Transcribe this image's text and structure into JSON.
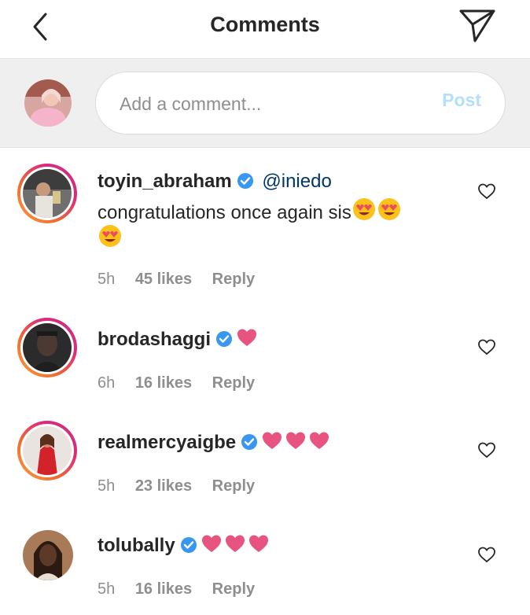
{
  "header": {
    "title": "Comments",
    "back_icon": "chevron-left-icon",
    "send_icon": "paper-plane-icon"
  },
  "composer": {
    "placeholder": "Add a comment...",
    "post_label": "Post"
  },
  "colors": {
    "post_disabled": "#b2dffc",
    "verified_blue": "#3897f0",
    "mention": "#00376b",
    "meta_gray": "#8e8e8e",
    "heart_pink": "#e75480",
    "composer_bg": "#efefef"
  },
  "comments": [
    {
      "username": "toyin_abraham",
      "verified": true,
      "mention": "@iniedo",
      "text": "congratulations once again sis",
      "emojis": "heart-eyes-face-icon x3",
      "time": "5h",
      "likes": "45 likes",
      "reply": "Reply"
    },
    {
      "username": "brodashaggi",
      "verified": true,
      "emojis": "pink-heart-icon x1",
      "time": "6h",
      "likes": "16 likes",
      "reply": "Reply"
    },
    {
      "username": "realmercyaigbe",
      "verified": true,
      "emojis": "pink-heart-icon x3",
      "time": "5h",
      "likes": "23 likes",
      "reply": "Reply"
    },
    {
      "username": "tolubally",
      "verified": true,
      "emojis": "pink-heart-icon x3",
      "time": "5h",
      "likes": "16 likes",
      "reply": "Reply"
    }
  ]
}
